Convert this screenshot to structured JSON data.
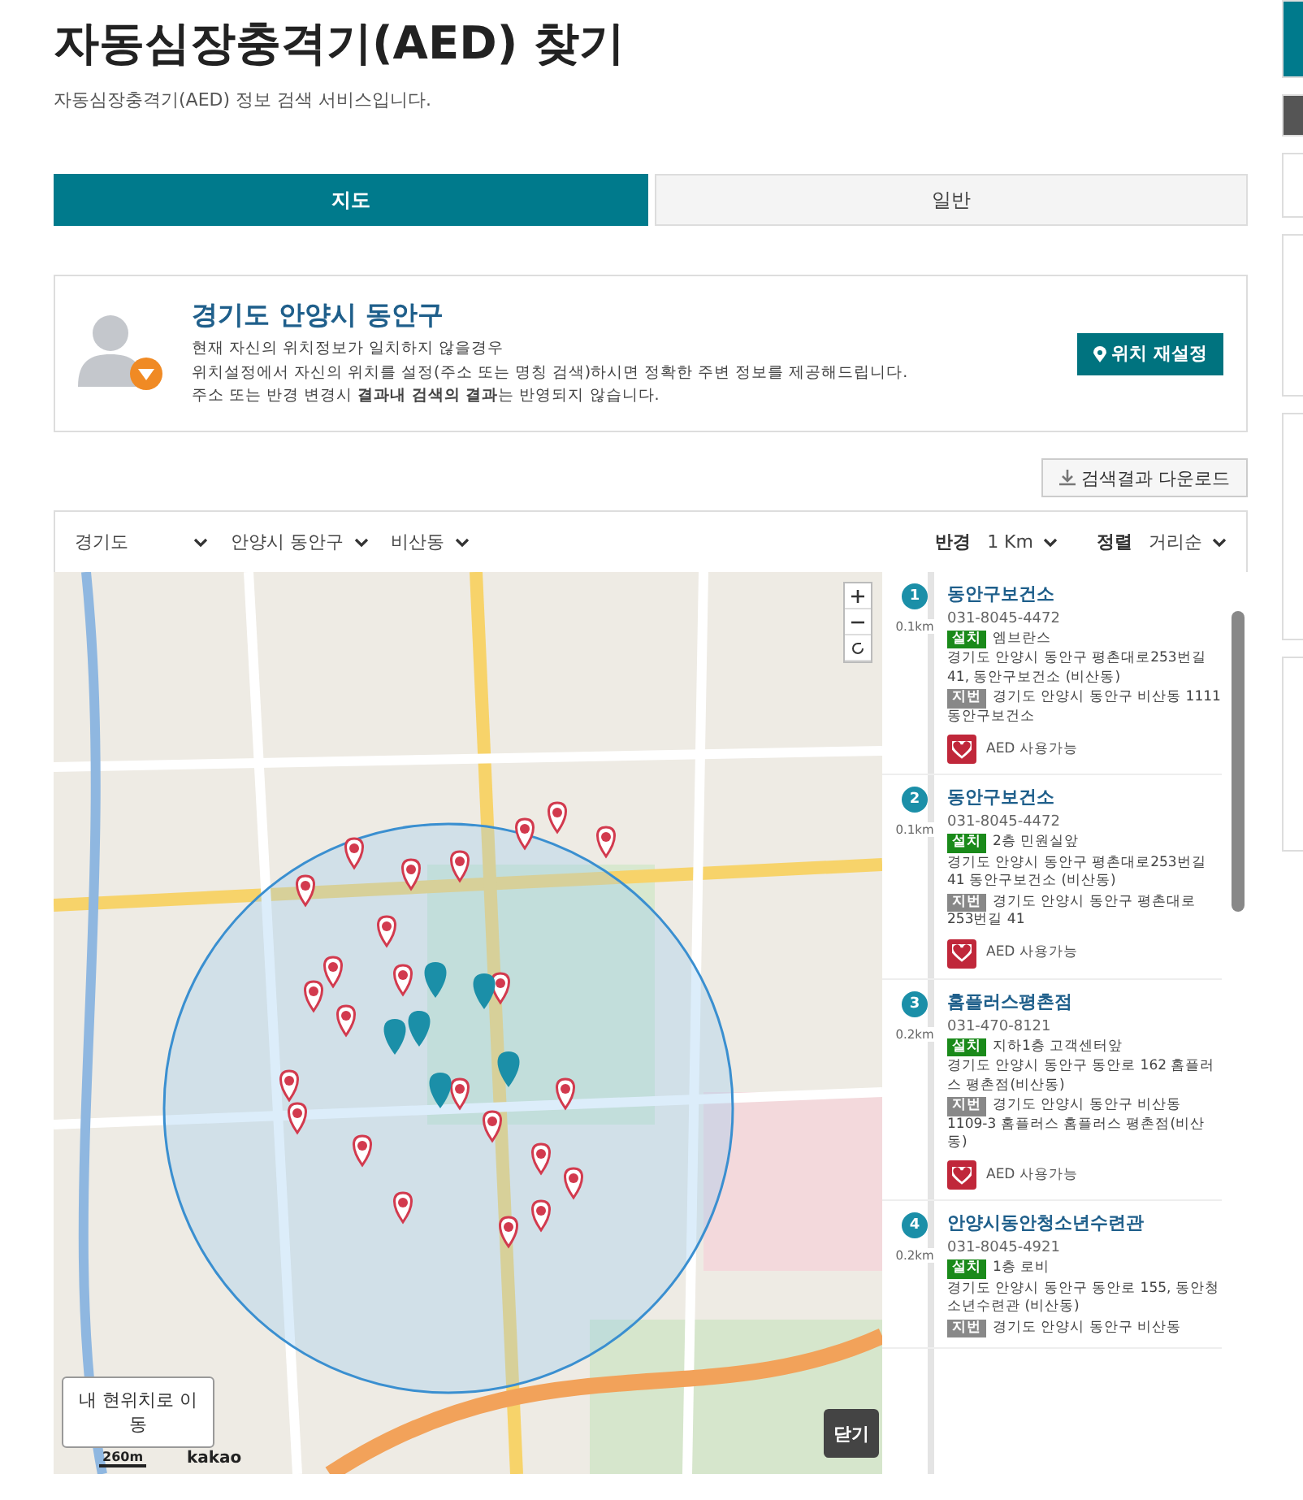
{
  "header": {
    "title": "자동심장충격기(AED) 찾기",
    "subtitle": "자동심장충격기(AED) 정보 검색 서비스입니다."
  },
  "tabs": [
    {
      "label": "지도",
      "selected": true
    },
    {
      "label": "일반",
      "selected": false
    }
  ],
  "location": {
    "region": "경기도 안양시 동안구",
    "notes": [
      "현재 자신의 위치정보가 일치하지 않을경우",
      "위치설정에서 자신의 위치를 설정(주소 또는 명칭 검색)하시면 정확한 주변 정보를 제공해드립니다.",
      "주소 또는 반경 변경시 **결과내 검색의 결과**는 반영되지 않습니다."
    ],
    "reset_button": "위치 재설정"
  },
  "download_button": "검색결과 다운로드",
  "filters": {
    "province": "경기도",
    "city": "안양시 동안구",
    "dong": "비산동",
    "radius_label": "반경",
    "radius": "1 Km",
    "sort_label": "정렬",
    "sort": "거리순"
  },
  "map": {
    "locate_button": "내 현위치로 이동",
    "close_button": "닫기",
    "scale": "260m",
    "logo": "kakao"
  },
  "results": [
    {
      "number": "1",
      "distance": "0.1km",
      "name": "동안구보건소",
      "phone": "031-8045-4472",
      "install_label": "설치",
      "install": "엠브란스",
      "road_address": "경기도 안양시 동안구 평촌대로253번길 41, 동안구보건소 (비산동)",
      "lot_label": "지번",
      "lot_address": "경기도 안양시 동안구 비산동 1111 동안구보건소",
      "status": "AED 사용가능"
    },
    {
      "number": "2",
      "distance": "0.1km",
      "name": "동안구보건소",
      "phone": "031-8045-4472",
      "install_label": "설치",
      "install": "2층 민원실앞",
      "road_address": "경기도 안양시 동안구 평촌대로253번길 41 동안구보건소 (비산동)",
      "lot_label": "지번",
      "lot_address": "경기도 안양시 동안구 평촌대로 253번길 41",
      "status": "AED 사용가능"
    },
    {
      "number": "3",
      "distance": "0.2km",
      "name": "홈플러스평촌점",
      "phone": "031-470-8121",
      "install_label": "설치",
      "install": "지하1층 고객센터앞",
      "road_address": "경기도 안양시 동안구 동안로 162 홈플러스 평촌점(비산동)",
      "lot_label": "지번",
      "lot_address": "경기도 안양시 동안구 비산동 1109-3 홈플러스 홈플러스 평촌점(비산동)",
      "status": "AED 사용가능"
    },
    {
      "number": "4",
      "distance": "0.2km",
      "name": "안양시동안청소년수련관",
      "phone": "031-8045-4921",
      "install_label": "설치",
      "install": "1층 로비",
      "road_address": "경기도 안양시 동안구 동안로 155, 동안청소년수련관 (비산동)",
      "lot_label": "지번",
      "lot_address": "경기도 안양시 동안구 비산동"
    }
  ]
}
